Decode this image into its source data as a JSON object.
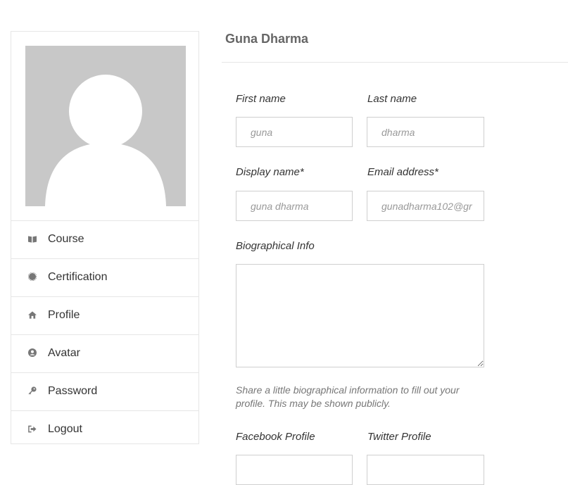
{
  "profile": {
    "display_name": "Guna Dharma"
  },
  "sidebar": {
    "items": [
      {
        "label": "Course",
        "icon": "book-icon"
      },
      {
        "label": "Certification",
        "icon": "badge-icon"
      },
      {
        "label": "Profile",
        "icon": "home-icon"
      },
      {
        "label": "Avatar",
        "icon": "user-circle-icon"
      },
      {
        "label": "Password",
        "icon": "key-icon"
      },
      {
        "label": "Logout",
        "icon": "logout-icon"
      }
    ]
  },
  "form": {
    "first_name": {
      "label": "First name",
      "placeholder": "guna"
    },
    "last_name": {
      "label": "Last name",
      "placeholder": "dharma"
    },
    "display_name": {
      "label": "Display name*",
      "placeholder": "guna dharma"
    },
    "email": {
      "label": "Email address*",
      "placeholder": "gunadharma102@gr"
    },
    "bio": {
      "label": "Biographical Info",
      "help": "Share a little biographical information to fill out your profile. This may be shown publicly."
    },
    "facebook": {
      "label": "Facebook Profile"
    },
    "twitter": {
      "label": "Twitter Profile"
    }
  },
  "colors": {
    "icon": "#777777",
    "avatar_bg": "#c8c8c8",
    "border": "#cfcfcf"
  }
}
